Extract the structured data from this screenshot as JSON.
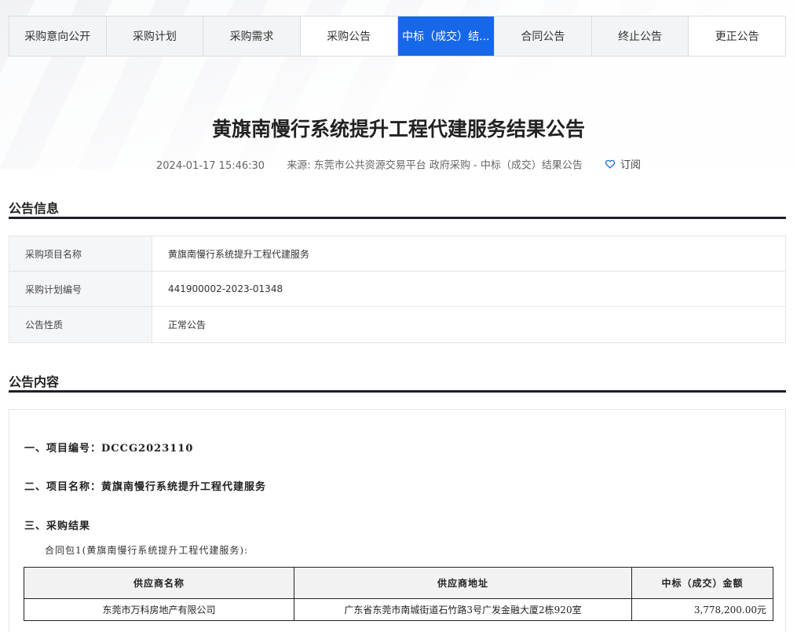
{
  "tabs": [
    {
      "label": "采购意向公开"
    },
    {
      "label": "采购计划"
    },
    {
      "label": "采购需求"
    },
    {
      "label": "采购公告"
    },
    {
      "label": "中标（成交）结..."
    },
    {
      "label": "合同公告"
    },
    {
      "label": "终止公告"
    },
    {
      "label": "更正公告"
    }
  ],
  "active_tab": 4,
  "accent_color": "#1768e8",
  "title": "黄旗南慢行系统提升工程代建服务结果公告",
  "meta": {
    "datetime": "2024-01-17 15:46:30",
    "source_label": "来源:",
    "source_value": "东莞市公共资源交易平台 政府采购 - 中标（成交）结果公告",
    "subscribe_label": "订阅",
    "subscribe_icon": "heart-icon"
  },
  "info_section": {
    "heading": "公告信息",
    "rows": [
      {
        "key": "采购项目名称",
        "value": "黄旗南慢行系统提升工程代建服务"
      },
      {
        "key": "采购计划编号",
        "value": "441900002-2023-01348"
      },
      {
        "key": "公告性质",
        "value": "正常公告"
      }
    ]
  },
  "content_section": {
    "heading": "公告内容",
    "line1": "一、项目编号：DCCG2023110",
    "line2": "二、项目名称：黄旗南慢行系统提升工程代建服务",
    "line3": "三、采购结果",
    "package_line": "合同包1(黄旗南慢行系统提升工程代建服务):",
    "table_headers": [
      "供应商名称",
      "供应商地址",
      "中标（成交）金额"
    ],
    "table_rows": [
      {
        "supplier": "东莞市万科房地产有限公司",
        "address": "广东省东莞市南城街道石竹路3号广发金融大厦2栋920室",
        "amount": "3,778,200.00元"
      }
    ]
  }
}
